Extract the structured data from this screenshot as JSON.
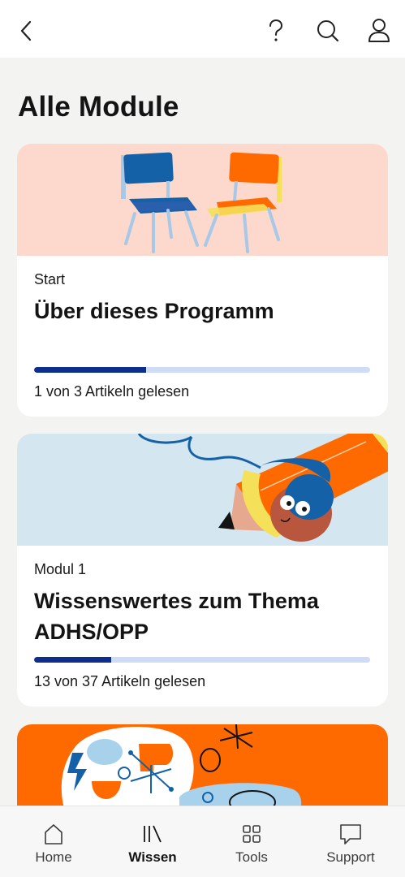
{
  "header": {
    "back_icon": "chevron-left-icon",
    "help_icon": "question-mark-icon",
    "search_icon": "search-icon",
    "profile_icon": "user-icon"
  },
  "page": {
    "title": "Alle Module"
  },
  "modules": [
    {
      "kicker": "Start",
      "title": "Über dieses Programm",
      "progress": 0.333,
      "status": "1 von 3 Artikeln gelesen",
      "banner_color": "#fdd8cd"
    },
    {
      "kicker": "Modul 1",
      "title": "Wissenswertes zum Thema ADHS/OPP",
      "progress": 0.23,
      "status": "13 von 37 Artikeln gelesen",
      "banner_color": "#d4e7f0"
    },
    {
      "banner_color": "#ff6a00"
    }
  ],
  "nav": {
    "items": [
      {
        "label": "Home",
        "icon": "home-icon",
        "active": false
      },
      {
        "label": "Wissen",
        "icon": "library-icon",
        "active": true
      },
      {
        "label": "Tools",
        "icon": "grid-icon",
        "active": false
      },
      {
        "label": "Support",
        "icon": "chat-bubble-icon",
        "active": false
      }
    ]
  },
  "colors": {
    "progress_fill": "#0e2e8c",
    "progress_track": "#cfdcf6",
    "background": "#f3f3f1"
  }
}
